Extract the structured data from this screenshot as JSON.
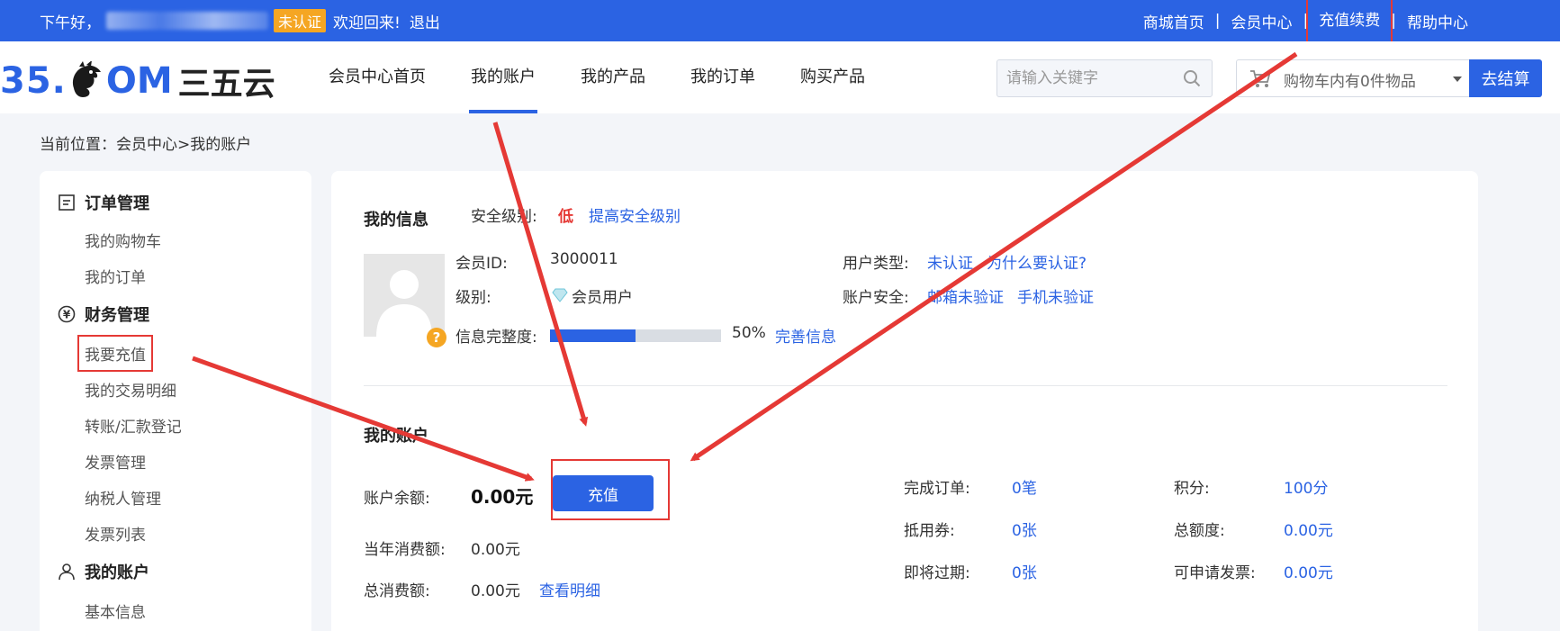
{
  "topbar": {
    "greeting": "下午好，",
    "badge": "未认证",
    "welcome": "欢迎回来!",
    "logout": "退出",
    "links": [
      "商城首页",
      "会员中心",
      "充值续费",
      "帮助中心"
    ],
    "separator": "|"
  },
  "header": {
    "logo": {
      "num": "35.",
      "om": "OM",
      "cn": "三五云"
    },
    "nav": [
      "会员中心首页",
      "我的账户",
      "我的产品",
      "我的订单",
      "购买产品"
    ],
    "active_nav": "我的账户",
    "search_placeholder": "请输入关键字",
    "cart_text": "购物车内有0件物品",
    "checkout": "去结算"
  },
  "breadcrumb": "当前位置：会员中心>我的账户",
  "sidebar": {
    "groups": [
      {
        "title": "订单管理",
        "icon": "list-icon",
        "items": [
          "我的购物车",
          "我的订单"
        ]
      },
      {
        "title": "财务管理",
        "icon": "yuan-icon",
        "items": [
          "我要充值",
          "我的交易明细",
          "转账/汇款登记",
          "发票管理",
          "纳税人管理",
          "发票列表"
        ]
      },
      {
        "title": "我的账户",
        "icon": "user-icon",
        "items": [
          "基本信息"
        ]
      }
    ]
  },
  "info": {
    "title": "我的信息",
    "security_label": "安全级别:",
    "security_value": "低",
    "security_link": "提高安全级别",
    "member_id_label": "会员ID:",
    "member_id": "3000011",
    "level_label": "级别:",
    "level": "会员用户",
    "completeness_label": "信息完整度:",
    "completeness": 50,
    "completeness_text": "50%",
    "complete_link": "完善信息",
    "user_type_label": "用户类型:",
    "user_type": "未认证",
    "why_link": "为什么要认证?",
    "account_security_label": "账户安全:",
    "email_status": "邮箱未验证",
    "phone_status": "手机未验证",
    "help_mark": "?"
  },
  "account": {
    "title": "我的账户",
    "balance_label": "账户余额:",
    "balance": "0.00元",
    "recharge": "充值",
    "year_label": "当年消费额:",
    "year_value": "0.00元",
    "total_label": "总消费额:",
    "total_value": "0.00元",
    "detail_link": "查看明细",
    "stats": [
      {
        "label": "完成订单:",
        "value": "0笔"
      },
      {
        "label": "积分:",
        "value": "100分"
      },
      {
        "label": "抵用券:",
        "value": "0张"
      },
      {
        "label": "总额度:",
        "value": "0.00元"
      },
      {
        "label": "即将过期:",
        "value": "0张"
      },
      {
        "label": "可申请发票:",
        "value": "0.00元"
      }
    ]
  },
  "colors": {
    "brand": "#2b63e3",
    "annotation": "#e53935",
    "badge": "#f5a623"
  }
}
